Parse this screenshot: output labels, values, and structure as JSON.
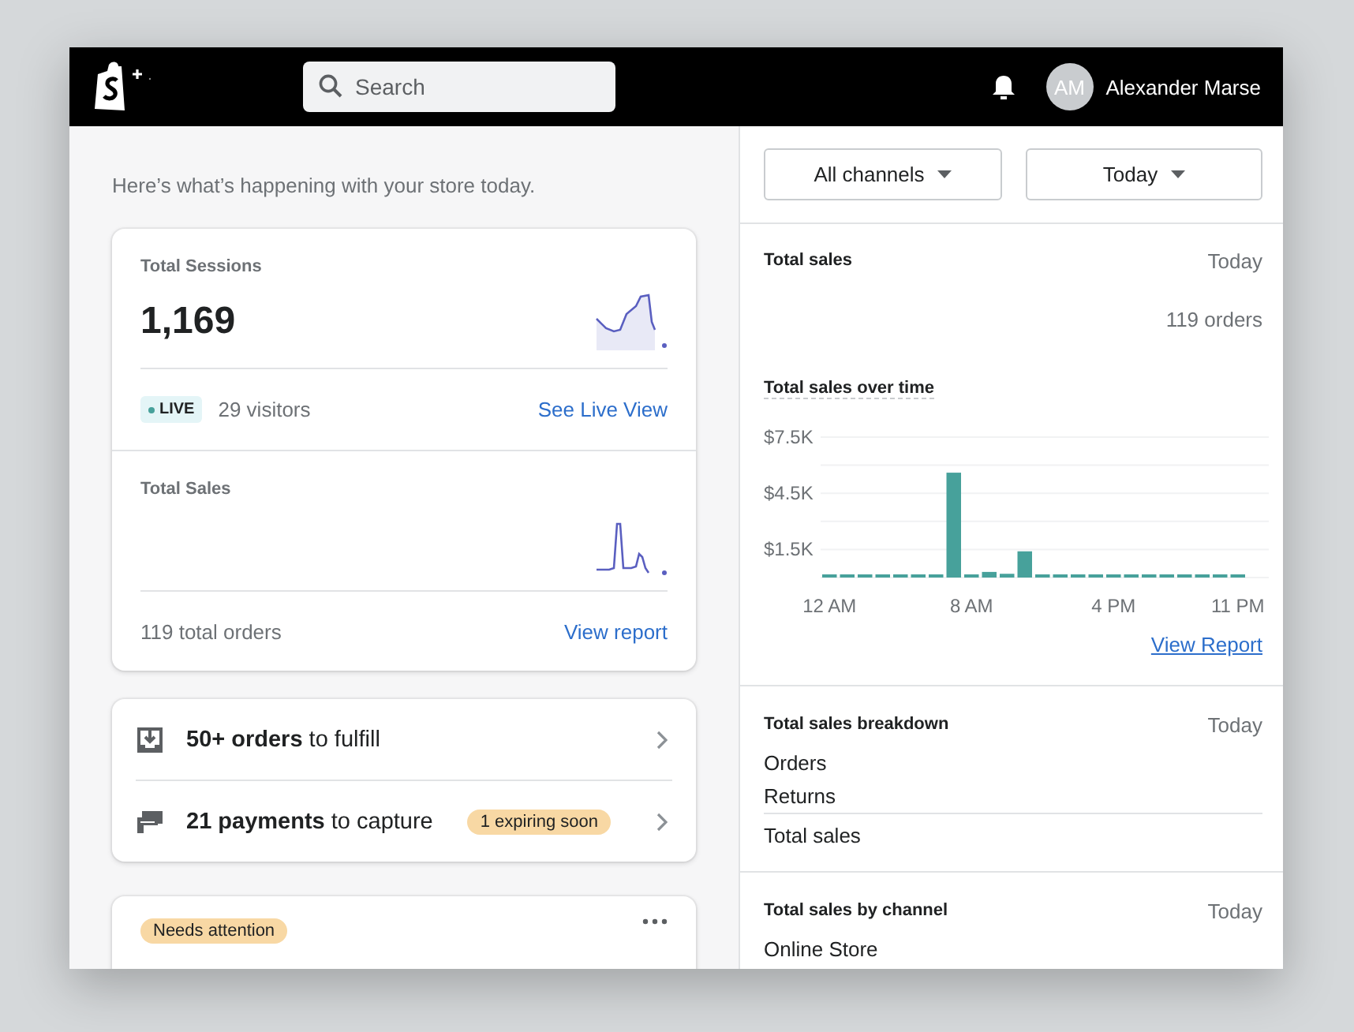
{
  "topbar": {
    "search": {
      "placeholder": "Search"
    },
    "user": {
      "initials": "AM",
      "name": "Alexander Marse"
    }
  },
  "greeting": "Here’s what’s happening with your store today.",
  "sessions_card": {
    "title": "Total Sessions",
    "value": "1,169",
    "live_badge": "LIVE",
    "visitors": "29 visitors",
    "link": "See Live View"
  },
  "sales_card": {
    "title": "Total Sales",
    "orders": "119 total orders",
    "link": "View report"
  },
  "tasks": [
    {
      "kind": "fulfill",
      "text": "**50+ orders** to fulfill"
    },
    {
      "kind": "capture",
      "text": "**21 payments** to capture",
      "badge": "1 expiring soon"
    }
  ],
  "attention_card": {
    "badge": "Needs attention"
  },
  "filters": [
    "All channels",
    "Today"
  ],
  "total_sales": {
    "title": "Total sales",
    "period": "Today",
    "orders": "119 orders",
    "chart_title": "Total sales over time",
    "link": "View Report",
    "chart_data": {
      "type": "bar",
      "categories": [
        "12 AM",
        null,
        null,
        null,
        null,
        null,
        null,
        null,
        "8 AM",
        null,
        null,
        null,
        null,
        null,
        null,
        null,
        "4 PM",
        null,
        null,
        null,
        null,
        null,
        null,
        "11 PM"
      ],
      "series": [
        {
          "color": "#47a19b",
          "values": [
            0,
            0,
            0,
            0,
            0,
            0,
            0,
            5600,
            0,
            300,
            200,
            1400,
            0,
            0,
            0,
            0,
            0,
            0,
            0,
            0,
            0,
            0,
            0,
            0
          ]
        }
      ],
      "ylim": [
        0,
        7500
      ],
      "yticks": [
        {
          "value": 1500,
          "label": "$1.5K"
        },
        {
          "value": 4500,
          "label": "$4.5K"
        },
        {
          "value": 7500,
          "label": "$7.5K"
        }
      ]
    }
  },
  "breakdown": {
    "title": "Total sales breakdown",
    "period": "Today",
    "rows": [
      "Orders",
      "Returns"
    ],
    "total": "Total sales"
  },
  "by_channel": {
    "title": "Total sales by channel",
    "period": "Today",
    "rows": [
      "Online Store"
    ]
  }
}
